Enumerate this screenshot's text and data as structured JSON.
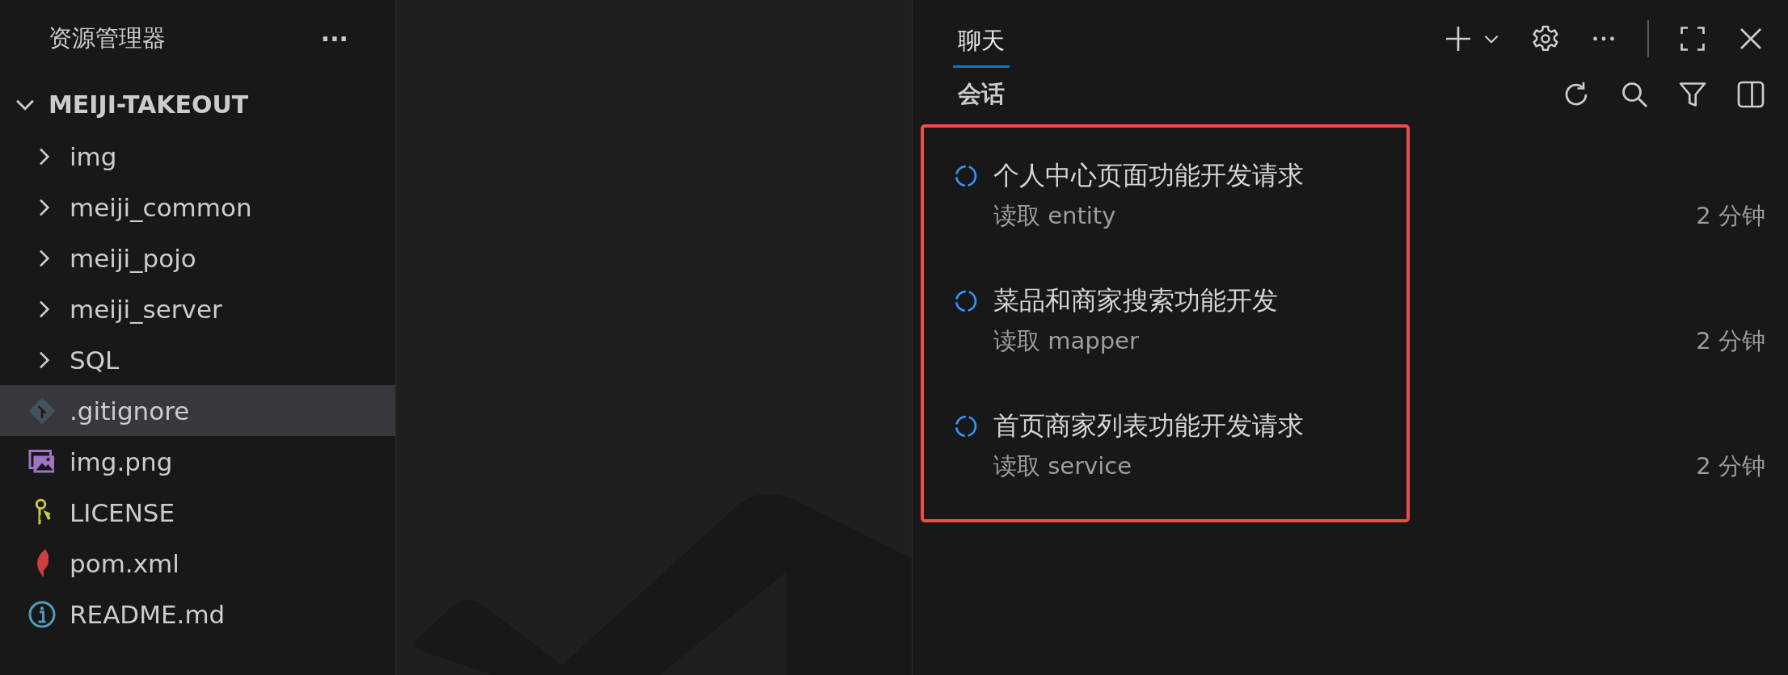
{
  "explorer": {
    "title": "资源管理器",
    "more": "···",
    "project": {
      "name": "MEIJI-TAKEOUT",
      "expanded": true
    },
    "items": [
      {
        "label": "img",
        "kind": "folder",
        "selected": false
      },
      {
        "label": "meiji_common",
        "kind": "folder",
        "selected": false
      },
      {
        "label": "meiji_pojo",
        "kind": "folder",
        "selected": false
      },
      {
        "label": "meiji_server",
        "kind": "folder",
        "selected": false
      },
      {
        "label": "SQL",
        "kind": "folder",
        "selected": false
      },
      {
        "label": ".gitignore",
        "kind": "git",
        "selected": true
      },
      {
        "label": "img.png",
        "kind": "image",
        "selected": false
      },
      {
        "label": "LICENSE",
        "kind": "license",
        "selected": false
      },
      {
        "label": "pom.xml",
        "kind": "maven",
        "selected": false
      },
      {
        "label": "README.md",
        "kind": "info",
        "selected": false
      }
    ]
  },
  "chat": {
    "tabs": [
      {
        "label": "聊天",
        "selected": true
      }
    ],
    "section": "会话",
    "highlighted": true,
    "sessions": [
      {
        "title": "个人中心页面功能开发请求",
        "detail": "读取 entity",
        "time": "2 分钟"
      },
      {
        "title": "菜品和商家搜索功能开发",
        "detail": "读取 mapper",
        "time": "2 分钟"
      },
      {
        "title": "首页商家列表功能开发请求",
        "detail": "读取 service",
        "time": "2 分钟"
      }
    ]
  }
}
